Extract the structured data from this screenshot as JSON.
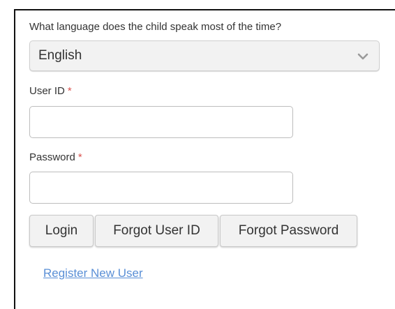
{
  "language": {
    "label": "What language does the child speak most of the time?",
    "selected": "English",
    "icon": "chevron-down-icon"
  },
  "user_id": {
    "label": "User ID",
    "required_mark": "*",
    "value": ""
  },
  "password": {
    "label": "Password",
    "required_mark": "*",
    "value": ""
  },
  "buttons": {
    "login": "Login",
    "forgot_user_id": "Forgot User ID",
    "forgot_password": "Forgot Password"
  },
  "links": {
    "register": "Register New User"
  },
  "colors": {
    "required": "#d9534f",
    "link": "#5a8fd6",
    "button_bg": "#f2f2f2"
  }
}
